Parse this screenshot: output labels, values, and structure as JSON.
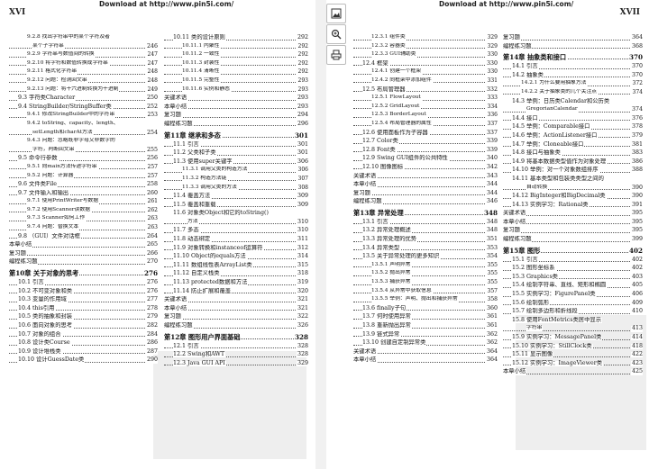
{
  "header": {
    "download_text": "Download at http://www.pin5i.com/",
    "left_page_num": "XVI",
    "right_page_num": "XVII"
  },
  "toolbar": {
    "tools": [
      "image-icon",
      "zoom-icon",
      "print-icon"
    ]
  },
  "left_col1": [
    {
      "lvl": 3,
      "text": "9.2.8  找出字符串中的某个字符及者",
      "page": ""
    },
    {
      "lvl": "cont",
      "text": "某个子字符串",
      "page": "246"
    },
    {
      "lvl": 3,
      "text": "9.2.9  字符串与数值间的转换",
      "page": "247"
    },
    {
      "lvl": 3,
      "text": "9.2.10  将字符和数值转换成字符串",
      "page": "247"
    },
    {
      "lvl": 3,
      "text": "9.2.11  格式化字符串",
      "page": "248"
    },
    {
      "lvl": 3,
      "text": "9.2.12  问题：检测回文串",
      "page": "248"
    },
    {
      "lvl": 3,
      "text": "9.2.13  问题：将十六进制转换为十进制",
      "page": "249"
    },
    {
      "lvl": 2,
      "text": "9.3  字符类Character",
      "page": "250"
    },
    {
      "lvl": 2,
      "text": "9.4  StringBuilder/StringBuffer类",
      "page": "252"
    },
    {
      "lvl": 3,
      "text": "9.4.1  修改StringBuilder中的字符串",
      "page": "253"
    },
    {
      "lvl": 3,
      "text": "9.4.2  toString、capacity、length、",
      "page": ""
    },
    {
      "lvl": "cont",
      "text": "setLength和charAt方法",
      "page": "254"
    },
    {
      "lvl": 3,
      "text": "9.4.3  问题：忽略既非字母又非数字的",
      "page": ""
    },
    {
      "lvl": "cont",
      "text": "字符，判断回文串",
      "page": "255"
    },
    {
      "lvl": 2,
      "text": "9.5  命令行参数",
      "page": "256"
    },
    {
      "lvl": 3,
      "text": "9.5.1  向main方法传递字符串",
      "page": "257"
    },
    {
      "lvl": 3,
      "text": "9.5.2  问题：计算器",
      "page": "257"
    },
    {
      "lvl": 2,
      "text": "9.6  文件类File",
      "page": "258"
    },
    {
      "lvl": 2,
      "text": "9.7  文件输入和输出",
      "page": "260"
    },
    {
      "lvl": 3,
      "text": "9.7.1  使用PrintWriter写数据",
      "page": "261"
    },
    {
      "lvl": 3,
      "text": "9.7.2  使用Scanner读数据",
      "page": "262"
    },
    {
      "lvl": 3,
      "text": "9.7.3  Scanner如何工作",
      "page": "263"
    },
    {
      "lvl": 3,
      "text": "9.7.4  问题：替换文本",
      "page": "263"
    },
    {
      "lvl": 2,
      "text": "9.8  （GUI）文件对话框",
      "page": "264"
    },
    {
      "lvl": 1,
      "text": "本章小结",
      "page": "265"
    },
    {
      "lvl": 1,
      "text": "复习题",
      "page": "266"
    },
    {
      "lvl": 1,
      "text": "编程练习题",
      "page": "270"
    },
    {
      "lvl": "ch",
      "text": "第10章  关于对象的思考",
      "page": "276"
    },
    {
      "lvl": 2,
      "text": "10.1  引言",
      "page": "276"
    },
    {
      "lvl": 2,
      "text": "10.2  不可变对象和类",
      "page": "276"
    },
    {
      "lvl": 2,
      "text": "10.3  变量的作用域",
      "page": "277"
    },
    {
      "lvl": 2,
      "text": "10.4  this引用",
      "page": "278"
    },
    {
      "lvl": 2,
      "text": "10.5  类的抽象和封装",
      "page": "279"
    },
    {
      "lvl": 2,
      "text": "10.6  面向对象的思考",
      "page": "282"
    },
    {
      "lvl": 2,
      "text": "10.7  对象的组合",
      "page": "284"
    },
    {
      "lvl": 2,
      "text": "10.8  设计类Course",
      "page": "286"
    },
    {
      "lvl": 2,
      "text": "10.9  设计堆栈类",
      "page": "287"
    },
    {
      "lvl": 2,
      "text": "10.10  设计GuessDate类",
      "page": "290"
    }
  ],
  "left_col2": [
    {
      "lvl": 2,
      "text": "10.11  类的设计原则",
      "page": "292"
    },
    {
      "lvl": 3,
      "text": "10.11.1  内聚性",
      "page": "292"
    },
    {
      "lvl": 3,
      "text": "10.11.2  一致性",
      "page": "292"
    },
    {
      "lvl": 3,
      "text": "10.11.3  封装性",
      "page": "292"
    },
    {
      "lvl": 3,
      "text": "10.11.4  清晰性",
      "page": "292"
    },
    {
      "lvl": 3,
      "text": "10.11.5  完整性",
      "page": "293"
    },
    {
      "lvl": 3,
      "text": "10.11.6  实例和静态",
      "page": "293"
    },
    {
      "lvl": 1,
      "text": "关键术语",
      "page": "293"
    },
    {
      "lvl": 1,
      "text": "本章小结",
      "page": "293"
    },
    {
      "lvl": 1,
      "text": "复习题",
      "page": "294"
    },
    {
      "lvl": 1,
      "text": "编程练习题",
      "page": "296"
    },
    {
      "lvl": "ch",
      "text": "第11章  继承和多态",
      "page": "301"
    },
    {
      "lvl": 2,
      "text": "11.1  引言",
      "page": "301"
    },
    {
      "lvl": 2,
      "text": "11.2  父类和子类",
      "page": "301"
    },
    {
      "lvl": 2,
      "text": "11.3  使用super关键字",
      "page": "306"
    },
    {
      "lvl": 3,
      "text": "11.3.1  调用父类的构造方法",
      "page": "306"
    },
    {
      "lvl": 3,
      "text": "11.3.2  构造方法链",
      "page": "307"
    },
    {
      "lvl": 3,
      "text": "11.3.3  调用父类的方法",
      "page": "308"
    },
    {
      "lvl": 2,
      "text": "11.4  覆盖方法",
      "page": "309"
    },
    {
      "lvl": 2,
      "text": "11.5  覆盖和重载",
      "page": "309"
    },
    {
      "lvl": 2,
      "text": "11.6  对象类Object和它的toString()",
      "page": ""
    },
    {
      "lvl": "cont",
      "text": "方法",
      "page": "310"
    },
    {
      "lvl": 2,
      "text": "11.7  多态",
      "page": "310"
    },
    {
      "lvl": 2,
      "text": "11.8  动态绑定",
      "page": "311"
    },
    {
      "lvl": 2,
      "text": "11.9  对象转换和instanceof运算符",
      "page": "312"
    },
    {
      "lvl": 2,
      "text": "11.10  Object的equals方法",
      "page": "314"
    },
    {
      "lvl": 2,
      "text": "11.11  数组线性表ArrayList类",
      "page": "315"
    },
    {
      "lvl": 2,
      "text": "11.12  自定义栈类",
      "page": "318"
    },
    {
      "lvl": 2,
      "text": "11.13  protected数据和方法",
      "page": "319"
    },
    {
      "lvl": 2,
      "text": "11.14  防止扩展和覆盖",
      "page": "320"
    },
    {
      "lvl": 1,
      "text": "关键术语",
      "page": "321"
    },
    {
      "lvl": 1,
      "text": "本章小结",
      "page": "321"
    },
    {
      "lvl": 1,
      "text": "复习题",
      "page": "322"
    },
    {
      "lvl": 1,
      "text": "编程练习题",
      "page": "326"
    },
    {
      "lvl": "ch",
      "text": "第12章  图形用户界面基础",
      "page": "328"
    },
    {
      "lvl": 2,
      "text": "12.1  引言",
      "page": "328"
    },
    {
      "lvl": 2,
      "text": "12.2  Swing和AWT",
      "page": "328"
    },
    {
      "lvl": 2,
      "text": "12.3  Java GUI API",
      "page": "329"
    }
  ],
  "right_col1": [
    {
      "lvl": 3,
      "text": "12.3.1  组件类",
      "page": "329"
    },
    {
      "lvl": 3,
      "text": "12.3.2  容器类",
      "page": "329"
    },
    {
      "lvl": 3,
      "text": "12.3.3  GUI辅助类",
      "page": "330"
    },
    {
      "lvl": 2,
      "text": "12.4  框架",
      "page": "330"
    },
    {
      "lvl": 3,
      "text": "12.4.1  创建一个框架",
      "page": "330"
    },
    {
      "lvl": 3,
      "text": "12.4.2  向框架中添加组件",
      "page": "331"
    },
    {
      "lvl": 2,
      "text": "12.5  布局管理器",
      "page": "332"
    },
    {
      "lvl": 3,
      "text": "12.5.1  FlowLayout",
      "page": "333"
    },
    {
      "lvl": 3,
      "text": "12.5.2  GridLayout",
      "page": "334"
    },
    {
      "lvl": 3,
      "text": "12.5.3  BorderLayout",
      "page": "336"
    },
    {
      "lvl": 3,
      "text": "12.5.4  布局管理器的属性",
      "page": "337"
    },
    {
      "lvl": 2,
      "text": "12.6  使用面板作为子容器",
      "page": "337"
    },
    {
      "lvl": 2,
      "text": "12.7  Color类",
      "page": "339"
    },
    {
      "lvl": 2,
      "text": "12.8  Font类",
      "page": "339"
    },
    {
      "lvl": 2,
      "text": "12.9  Swing GUI组件的公共特性",
      "page": "340"
    },
    {
      "lvl": 2,
      "text": "12.10  图像图标",
      "page": "342"
    },
    {
      "lvl": 1,
      "text": "关键术语",
      "page": "343"
    },
    {
      "lvl": 1,
      "text": "本章小结",
      "page": "344"
    },
    {
      "lvl": 1,
      "text": "复习题",
      "page": "344"
    },
    {
      "lvl": 1,
      "text": "编程练习题",
      "page": "346"
    },
    {
      "lvl": "ch",
      "text": "第13章  异常处理",
      "page": "348"
    },
    {
      "lvl": 2,
      "text": "13.1  引言",
      "page": "348"
    },
    {
      "lvl": 2,
      "text": "13.2  异常处理概述",
      "page": "348"
    },
    {
      "lvl": 2,
      "text": "13.3  异常处理的优势",
      "page": "351"
    },
    {
      "lvl": 2,
      "text": "13.4  异常类型",
      "page": "353"
    },
    {
      "lvl": 2,
      "text": "13.5  关于异常处理的更多知识",
      "page": "354"
    },
    {
      "lvl": 3,
      "text": "13.5.1  声明异常",
      "page": "355"
    },
    {
      "lvl": 3,
      "text": "13.5.2  抛出异常",
      "page": "355"
    },
    {
      "lvl": 3,
      "text": "13.5.3  捕获异常",
      "page": "355"
    },
    {
      "lvl": 3,
      "text": "13.5.4  从异常中获取信息",
      "page": "357"
    },
    {
      "lvl": 3,
      "text": "13.5.5  举例：声明、抛出和捕获异常",
      "page": "358"
    },
    {
      "lvl": 2,
      "text": "13.6  finally子句",
      "page": "360"
    },
    {
      "lvl": 2,
      "text": "13.7  何时使用异常",
      "page": "361"
    },
    {
      "lvl": 2,
      "text": "13.8  重新抛出异常",
      "page": "361"
    },
    {
      "lvl": 2,
      "text": "13.9  链式异常",
      "page": "362"
    },
    {
      "lvl": 2,
      "text": "13.10  创建自定制异常类",
      "page": "362"
    },
    {
      "lvl": 1,
      "text": "关键术语",
      "page": "364"
    },
    {
      "lvl": 1,
      "text": "本章小结",
      "page": "364"
    }
  ],
  "right_col2": [
    {
      "lvl": 1,
      "text": "复习题",
      "page": "364"
    },
    {
      "lvl": 1,
      "text": "编程练习题",
      "page": "368"
    },
    {
      "lvl": "ch",
      "text": "第14章  抽象类和接口",
      "page": "370"
    },
    {
      "lvl": 2,
      "text": "14.1  引言",
      "page": "370"
    },
    {
      "lvl": 2,
      "text": "14.2  抽象类",
      "page": "370"
    },
    {
      "lvl": 3,
      "text": "14.2.1  为什么要用抽象方法",
      "page": "372"
    },
    {
      "lvl": 3,
      "text": "14.2.2  关于抽象类的几个关注点",
      "page": "374"
    },
    {
      "lvl": 2,
      "text": "14.3  举例：日历类Calendar和公历类",
      "page": ""
    },
    {
      "lvl": "cont",
      "text": "GregorianCalendar",
      "page": "374"
    },
    {
      "lvl": 2,
      "text": "14.4  接口",
      "page": "376"
    },
    {
      "lvl": 2,
      "text": "14.5  举例：Comparable接口",
      "page": "378"
    },
    {
      "lvl": 2,
      "text": "14.6  举例：ActionListener接口",
      "page": "379"
    },
    {
      "lvl": 2,
      "text": "14.7  举例：Cloneable接口",
      "page": "381"
    },
    {
      "lvl": 2,
      "text": "14.8  接口与抽象类",
      "page": "383"
    },
    {
      "lvl": 2,
      "text": "14.9  将基本数据类型值作为对象处理",
      "page": "386"
    },
    {
      "lvl": 2,
      "text": "14.10  举例：对一个对象数组排序",
      "page": "388"
    },
    {
      "lvl": 2,
      "text": "14.11  基本类型和包装类类型之间的",
      "page": ""
    },
    {
      "lvl": "cont",
      "text": "自动转换",
      "page": "390"
    },
    {
      "lvl": 2,
      "text": "14.12  BigInteger和BigDecimal类",
      "page": "390"
    },
    {
      "lvl": 2,
      "text": "14.13  实例学习：Rational类",
      "page": "391"
    },
    {
      "lvl": 1,
      "text": "关键术语",
      "page": "395"
    },
    {
      "lvl": 1,
      "text": "本章小结",
      "page": "395"
    },
    {
      "lvl": 1,
      "text": "复习题",
      "page": "395"
    },
    {
      "lvl": 1,
      "text": "编程练习题",
      "page": "399"
    },
    {
      "lvl": "ch",
      "text": "第15章  图形",
      "page": "402"
    },
    {
      "lvl": 2,
      "text": "15.1  引言",
      "page": "402"
    },
    {
      "lvl": 2,
      "text": "15.2  图形坐标系",
      "page": "402"
    },
    {
      "lvl": 2,
      "text": "15.3  Graphics类",
      "page": "403"
    },
    {
      "lvl": 2,
      "text": "15.4  绘制字符串、直线、矩形和椭圆",
      "page": "405"
    },
    {
      "lvl": 2,
      "text": "15.5  实例学习：FigurePanel类",
      "page": "406"
    },
    {
      "lvl": 2,
      "text": "15.6  绘制弧形",
      "page": "409"
    },
    {
      "lvl": 2,
      "text": "15.7  绘制多边形和折线段",
      "page": "410"
    },
    {
      "lvl": 2,
      "text": "15.8  使用FontMetrics类居中显示",
      "page": ""
    },
    {
      "lvl": "cont",
      "text": "字符串",
      "page": "413"
    },
    {
      "lvl": 2,
      "text": "15.9  实例学习：MessagePanel类",
      "page": "414"
    },
    {
      "lvl": 2,
      "text": "15.10  实例学习：StillClock类",
      "page": "418"
    },
    {
      "lvl": 2,
      "text": "15.11  显示图像",
      "page": "422"
    },
    {
      "lvl": 2,
      "text": "15.12  实例学习：ImageViewer类",
      "page": "423"
    },
    {
      "lvl": 1,
      "text": "本章小结",
      "page": "425"
    }
  ]
}
